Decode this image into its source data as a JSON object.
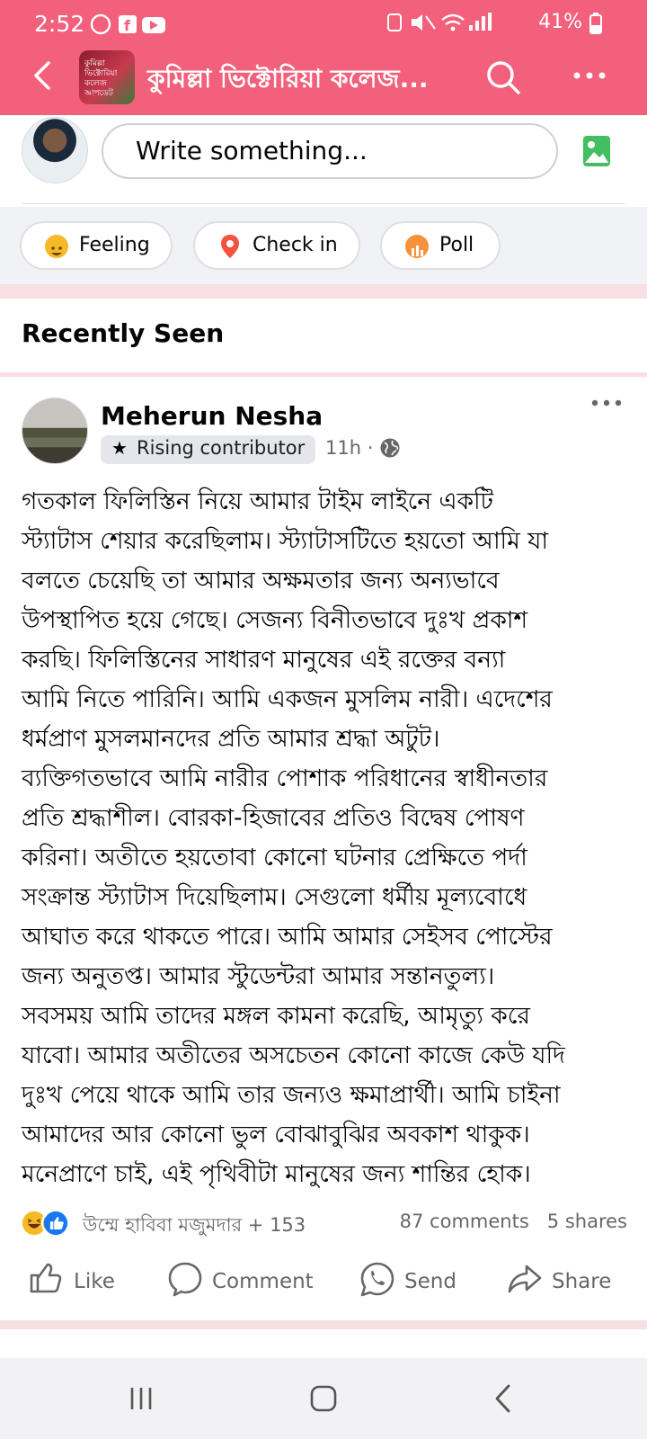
{
  "status_bar": {
    "time": "2:52",
    "battery": "41%"
  },
  "header": {
    "group_title": "কুমিল্লা ভিক্টোরিয়া কলেজ...",
    "group_thumb_text": "কুমিল্লা ভিক্টোরিয়া কলেজ আপডেট",
    "accent_color": "#f2607b"
  },
  "composer": {
    "placeholder": "Write something..."
  },
  "quick_actions": [
    {
      "label": "Feeling"
    },
    {
      "label": "Check in"
    },
    {
      "label": "Poll"
    }
  ],
  "section": {
    "title": "Recently Seen"
  },
  "post": {
    "author": "Meherun Nesha",
    "badge": "Rising contributor",
    "time_ago": "11h",
    "lines": [
      "গতকাল ফিলিস্তিন নিয়ে আমার টাইম লাইনে একটি",
      "স্ট্যাটাস শেয়ার করেছিলাম। স্ট্যাটাসটিতে হয়তো আমি যা",
      "বলতে চেয়েছি তা আমার অক্ষমতার জন্য অন্যভাবে",
      "উপস্থাপিত হয়ে গেছে। সেজন্য বিনীতভাবে দুঃখ প্রকাশ",
      "করছি। ফিলিস্তিনের সাধারণ মানুষের এই রক্তের বন্যা",
      "আমি নিতে পারিনি। আমি একজন মুসলিম নারী। এদেশের",
      "ধর্মপ্রাণ মুসলমানদের প্রতি আমার শ্রদ্ধা অটুট।",
      "ব্যক্তিগতভাবে আমি নারীর পোশাক পরিধানের স্বাধীনতার",
      "প্রতি শ্রদ্ধাশীল। বোরকা-হিজাবের প্রতিও বিদ্বেষ পোষণ",
      "করিনা। অতীতে হয়তোবা কোনো ঘটনার প্রেক্ষিতে পর্দা",
      "সংক্রান্ত স্ট্যাটাস দিয়েছিলাম। সেগুলো ধর্মীয় মূল্যবোধে",
      "আঘাত করে থাকতে পারে। আমি আমার সেইসব পোস্টের",
      "জন্য অনুতপ্ত। আমার স্টুডেন্টরা আমার সন্তানতুল্য।",
      "সবসময় আমি তাদের মঙ্গল কামনা করেছি, আমৃত্যু করে",
      "যাবো। আমার অতীতের অসচেতন কোনো কাজে কেউ যদি",
      "দুঃখ পেয়ে থাকে আমি তার জন্যও ক্ষমাপ্রার্থী। আমি চাইনা",
      "আমাদের আর কোনো ভুল বোঝাবুঝির অবকাশ থাকুক।",
      "মনেপ্রাণে চাই, এই পৃথিবীটা মানুষের জন্য শান্তির হোক।"
    ],
    "reactions_text": "উম্মে হাবিবা মজুমদার + 153",
    "comments": "87 comments",
    "shares": "5 shares"
  },
  "post_actions": [
    {
      "label": "Like"
    },
    {
      "label": "Comment"
    },
    {
      "label": "Send"
    },
    {
      "label": "Share"
    }
  ]
}
